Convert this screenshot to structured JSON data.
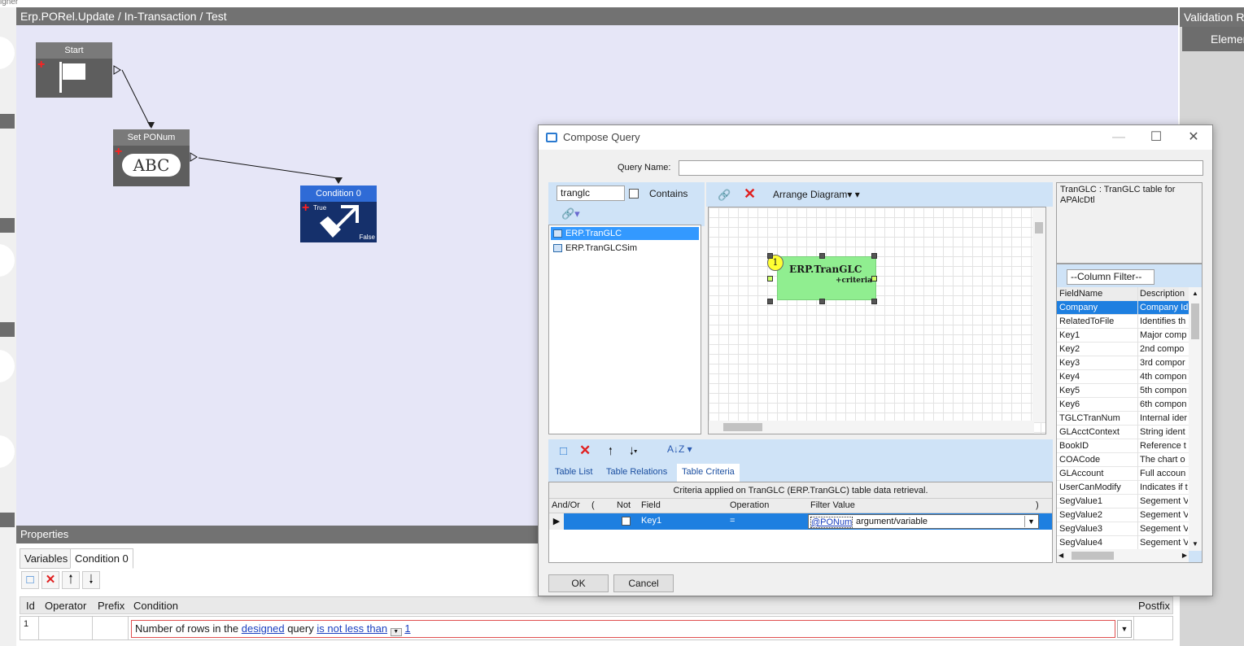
{
  "app": {
    "designer_label": "igner"
  },
  "document": {
    "title": "Erp.PORel.Update / In-Transaction / Test"
  },
  "nodes": {
    "start": {
      "title": "Start"
    },
    "set_ponum": {
      "title": "Set PONum",
      "icon_text": "ABC"
    },
    "condition": {
      "title": "Condition 0",
      "true_label": "True",
      "false_label": "False"
    }
  },
  "validation": {
    "title": "Validation Re",
    "element_col": "Elemen"
  },
  "properties": {
    "title": "Properties",
    "tabs": [
      "Variables",
      "Condition 0"
    ],
    "grid_headers": {
      "id": "Id",
      "operator": "Operator",
      "prefix": "Prefix",
      "condition": "Condition",
      "postfix": "Postfix"
    },
    "row": {
      "id": "1",
      "text1": "Number of rows in the",
      "link1": "designed",
      "text2": "query",
      "link2": "is not less than",
      "link3": "1"
    }
  },
  "dialog": {
    "title": "Compose Query",
    "query_name_label": "Query Name:",
    "query_name_value": "",
    "search_value": "tranglc",
    "contains_label": "Contains",
    "arrange_label": "Arrange Diagram",
    "tables": [
      "ERP.TranGLC",
      "ERP.TranGLCSim"
    ],
    "diagram_table": {
      "badge": "1",
      "name": "ERP.TranGLC",
      "sub": "+criteria"
    },
    "lower_tabs": [
      "Table List",
      "Table Relations",
      "Table Criteria"
    ],
    "criteria_caption": "Criteria applied on TranGLC (ERP.TranGLC)  table data retrieval.",
    "criteria_headers": {
      "andor": "And/Or",
      "open": "(",
      "not": "Not",
      "field": "Field",
      "operation": "Operation",
      "filter": "Filter Value",
      "close": ")"
    },
    "criteria_row": {
      "field": "Key1",
      "operation": "=",
      "filter_link": "@PONum",
      "filter_text": "argument/variable"
    },
    "description": "TranGLC : TranGLC table for APAlcDtl",
    "column_filter": "--Column Filter--",
    "columns_headers": {
      "field": "FieldName",
      "desc": "Description"
    },
    "columns": [
      {
        "f": "Company",
        "d": "Company Id"
      },
      {
        "f": "RelatedToFile",
        "d": "Identifies th"
      },
      {
        "f": "Key1",
        "d": "Major comp"
      },
      {
        "f": "Key2",
        "d": "2nd compo"
      },
      {
        "f": "Key3",
        "d": "3rd compor"
      },
      {
        "f": "Key4",
        "d": "4th compon"
      },
      {
        "f": "Key5",
        "d": "5th compon"
      },
      {
        "f": "Key6",
        "d": "6th compon"
      },
      {
        "f": "TGLCTranNum",
        "d": "Internal ider"
      },
      {
        "f": "GLAcctContext",
        "d": "String ident"
      },
      {
        "f": "BookID",
        "d": "Reference t"
      },
      {
        "f": "COACode",
        "d": "The chart o"
      },
      {
        "f": "GLAccount",
        "d": "Full accoun"
      },
      {
        "f": "UserCanModify",
        "d": "Indicates if t"
      },
      {
        "f": "SegValue1",
        "d": "Segement V"
      },
      {
        "f": "SegValue2",
        "d": "Segement V"
      },
      {
        "f": "SegValue3",
        "d": "Segement V"
      },
      {
        "f": "SegValue4",
        "d": "Segement V"
      }
    ],
    "ok_label": "OK",
    "cancel_label": "Cancel"
  },
  "colors": {
    "accent": "#1e7fe0",
    "node_gray": "#5e5e5e",
    "condition_blue": "#15306b",
    "canvas": "#e6e6f7",
    "table_green": "#90ee90"
  }
}
